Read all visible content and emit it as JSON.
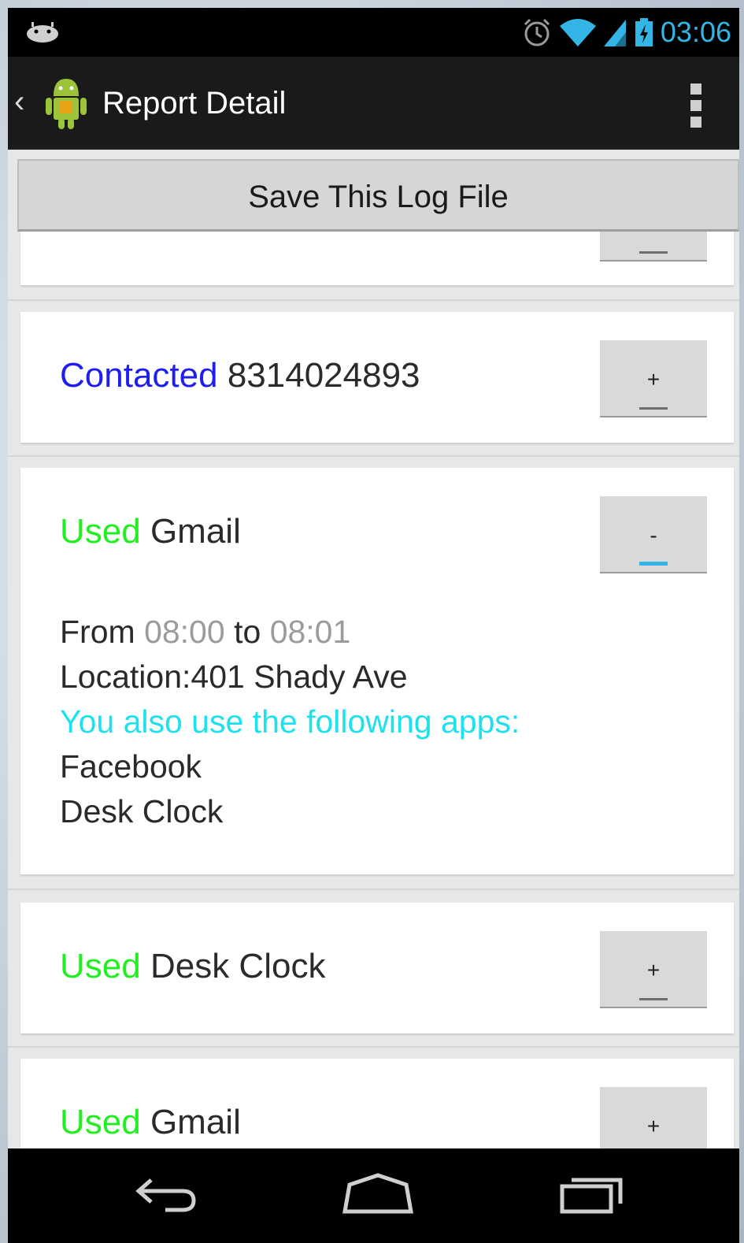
{
  "status_bar": {
    "time": "03:06",
    "icons": [
      "android-notification-icon",
      "alarm-icon",
      "wifi-icon",
      "cell-signal-icon",
      "battery-charging-icon"
    ]
  },
  "action_bar": {
    "title": "Report Detail",
    "back_icon": "chevron-left-icon",
    "app_icon": "android-app-icon",
    "overflow_icon": "overflow-menu-icon"
  },
  "save_button": {
    "label": "Save This Log File"
  },
  "entries": [
    {
      "verb": "",
      "subject": "",
      "toggle": ""
    },
    {
      "verb": "Contacted",
      "subject": "8314024893",
      "toggle": "+"
    },
    {
      "verb": "Used",
      "subject": "Gmail",
      "toggle": "-",
      "details": {
        "from_label": "From",
        "from_time": "08:00",
        "to_label": "to",
        "to_time": "08:01",
        "location": "Location:401 Shady Ave",
        "apps_header": "You also use the following apps:",
        "apps": [
          "Facebook",
          "Desk Clock"
        ]
      }
    },
    {
      "verb": "Used",
      "subject": "Desk Clock",
      "toggle": "+"
    },
    {
      "verb": "Used",
      "subject": "Gmail",
      "toggle": "+"
    }
  ],
  "colors": {
    "contacted": "#1e1ef0",
    "used": "#22ee22",
    "time_grey": "#9b9b9b",
    "apps_header": "#1ee1ee",
    "holo_blue": "#33b5e5"
  },
  "nav_bar": {
    "icons": [
      "back-icon",
      "home-icon",
      "recent-apps-icon"
    ]
  }
}
